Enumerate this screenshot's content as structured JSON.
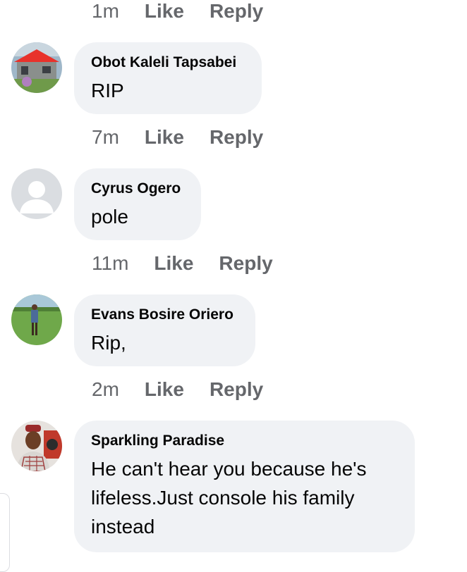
{
  "comments_prev": {
    "time": "1m",
    "like_label": "Like",
    "reply_label": "Reply"
  },
  "comments": [
    {
      "author": "Obot Kaleli Tapsabei",
      "text": "RIP",
      "time": "7m",
      "like_label": "Like",
      "reply_label": "Reply",
      "avatar_icon": "house-photo-avatar"
    },
    {
      "author": "Cyrus Ogero",
      "text": "pole",
      "time": "11m",
      "like_label": "Like",
      "reply_label": "Reply",
      "avatar_icon": "default-person-avatar"
    },
    {
      "author": "Evans Bosire Oriero",
      "text": "Rip,",
      "time": "2m",
      "like_label": "Like",
      "reply_label": "Reply",
      "avatar_icon": "person-in-field-avatar"
    },
    {
      "author": "Sparkling Paradise",
      "text": "He can't hear you because he's lifeless.Just console his family instead",
      "avatar_icon": "person-portrait-avatar"
    }
  ],
  "colors": {
    "bubble_bg": "#f0f2f5",
    "meta_text": "#65676b",
    "primary_text": "#050505"
  }
}
